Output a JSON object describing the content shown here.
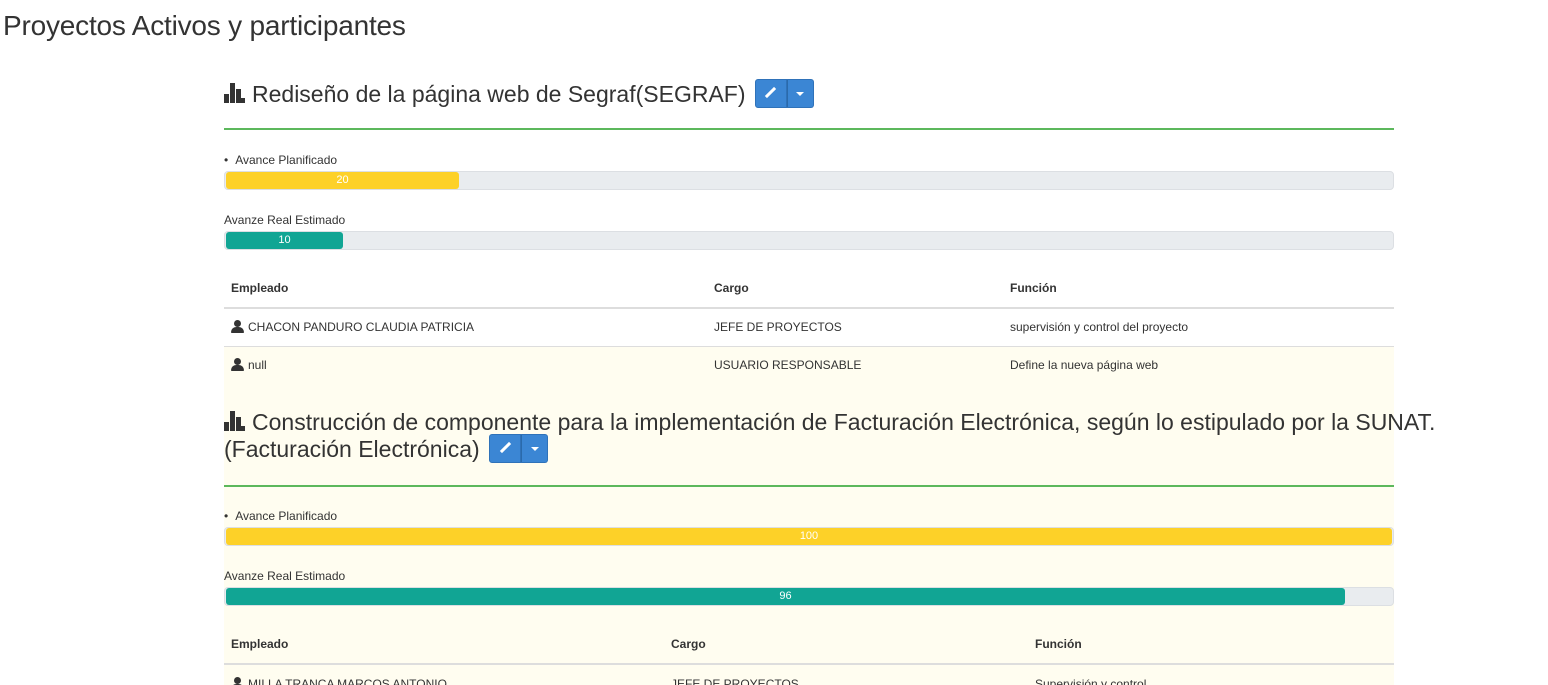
{
  "page": {
    "title": "Proyectos Activos y participantes"
  },
  "projects": [
    {
      "title": "Rediseño de la página web de Segraf(SEGRAF)",
      "planned": {
        "label": "Avance Planificado",
        "value": "20",
        "percent": 20
      },
      "actual": {
        "label": "Avanze Real Estimado",
        "value": "10",
        "percent": 10
      },
      "table": {
        "headers": [
          "Empleado",
          "Cargo",
          "Función"
        ],
        "rows": [
          [
            "CHACON PANDURO CLAUDIA PATRICIA",
            "JEFE DE PROYECTOS",
            "supervisión y control del proyecto"
          ],
          [
            "null",
            "USUARIO RESPONSABLE",
            "Define la nueva página web"
          ]
        ]
      }
    },
    {
      "title_line1": "Construcción de componente para la implementación de Facturación Electrónica, según lo estipulado por la SUNAT.",
      "title_line2": "(Facturación Electrónica)",
      "planned": {
        "label": "Avance Planificado",
        "value": "100",
        "percent": 100
      },
      "actual": {
        "label": "Avanze Real Estimado",
        "value": "96",
        "percent": 96
      },
      "table": {
        "headers": [
          "Empleado",
          "Cargo",
          "Función"
        ],
        "rows": [
          [
            "MILLA TRANCA MARCOS ANTONIO",
            "JEFE DE PROYECTOS",
            "Supervisión y control"
          ]
        ]
      }
    }
  ],
  "icons": {
    "project": "bar-chart-icon",
    "edit": "pencil-icon",
    "menu": "caret-down-icon",
    "employee": "user-icon"
  },
  "colors": {
    "planned_bar": "#fdd128",
    "actual_bar": "#11a594",
    "divider": "#5cb85c",
    "button": "#3b86d4"
  }
}
